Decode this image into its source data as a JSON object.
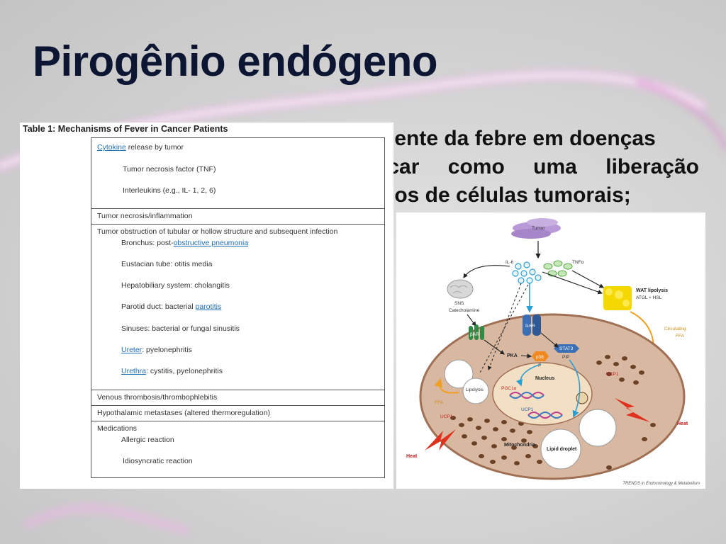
{
  "slide": {
    "title": "Pirogênio endógeno",
    "body_lines": [
      "uente da febre em doenças",
      "icar  como  uma  liberação",
      "pos de células tumorais;"
    ]
  },
  "table": {
    "caption": "Table 1:  Mechanisms of Fever in Cancer Patients",
    "sections": [
      {
        "rows": [
          {
            "link": "Cytokine",
            "text": " release by tumor"
          },
          {
            "text": "Tumor necrosis factor (TNF)"
          },
          {
            "text": "Interleukins (e.g., IL- 1, 2, 6)"
          }
        ]
      },
      {
        "rows": [
          {
            "text": "Tumor necrosis/inflammation"
          }
        ]
      },
      {
        "rows": [
          {
            "text": "Tumor obstruction of tubular or hollow structure and subsequent infection"
          },
          {
            "text": "Bronchus:  post-",
            "link": "obstructive pneumonia"
          },
          {
            "text": "Eustacian tube:  otitis media"
          },
          {
            "text": "Hepatobiliary system:  cholangitis"
          },
          {
            "text": "Parotid duct:  bacterial ",
            "link": "parotitis"
          },
          {
            "text": "Sinuses:  bacterial or fungal sinusitis"
          },
          {
            "link": "Ureter",
            "text": ":  pyelonephritis"
          },
          {
            "link": "Urethra",
            "text": ":  cystitis, pyelonephritis"
          }
        ]
      },
      {
        "rows": [
          {
            "text": "Venous thrombosis/thrombophlebitis"
          }
        ]
      },
      {
        "rows": [
          {
            "text": "Hypothalamic metastases (altered thermoregulation)"
          }
        ]
      },
      {
        "rows": [
          {
            "text": "Medications"
          },
          {
            "text": "Allergic reaction"
          },
          {
            "text": "Idiosyncratic reaction"
          }
        ]
      }
    ]
  },
  "figure": {
    "labels": {
      "tumor": "Tumor",
      "il6": "IL-6",
      "tnf": "TNFα",
      "sns": "SNS",
      "catecholamine": "Catecholamine",
      "wat_lipolysis": "WAT lipolysis",
      "atgl_hsl": "ATGL + HSL",
      "circulating": "Circulating",
      "ffa": "FFA",
      "bar": "βAR",
      "il6r": "IL6R",
      "stat3": "STAT3",
      "pip": "PIP",
      "pka": "PKA",
      "p38": "p38",
      "p": "P",
      "lipolysis": "Lipolysis",
      "nucleus": "Nucleus",
      "pgc1a": "PGC1α",
      "ucp1": "UCP1",
      "ffa_small": "FFA",
      "mitochondria": "Mitochondria",
      "lipid_droplet": "Lipid droplet",
      "heat": "Heat"
    },
    "credit": "TRENDS in Endocrinology & Metabolism",
    "colors": {
      "cell_fill": "#d9b8a2",
      "nucleus_fill": "#f3e0c4",
      "wat": "#f5d800",
      "receptor": "#2f8a45",
      "il6r": "#3a6fb5",
      "mito": "#6b4226",
      "heat": "#e0301e"
    }
  }
}
